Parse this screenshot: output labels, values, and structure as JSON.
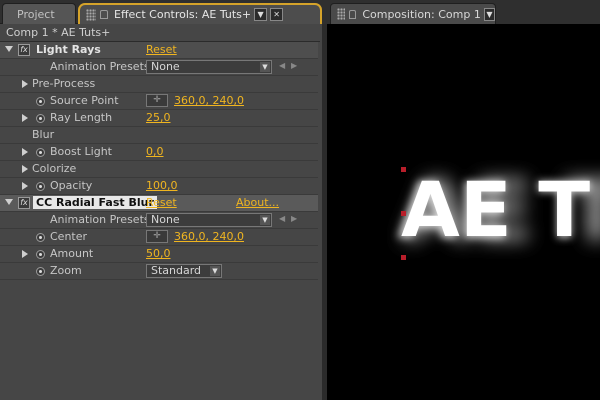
{
  "tabs": {
    "project": "Project",
    "effect_controls": "Effect Controls: AE Tuts+",
    "composition": "Composition: Comp 1"
  },
  "panel": {
    "comp_label": "Comp 1 * AE Tuts+"
  },
  "effects": [
    {
      "name": "Light Rays",
      "reset": "Reset",
      "presets_label": "Animation Presets:",
      "presets_value": "None",
      "params": {
        "pre_process": "Pre-Process",
        "source_point_label": "Source Point",
        "source_point_value": "360,0, 240,0",
        "ray_length_label": "Ray Length",
        "ray_length_value": "25,0",
        "blur": "Blur",
        "boost_light_label": "Boost Light",
        "boost_light_value": "0,0",
        "colorize": "Colorize",
        "opacity_label": "Opacity",
        "opacity_value": "100,0"
      }
    },
    {
      "name": "CC Radial Fast Blur",
      "reset": "Reset",
      "about": "About...",
      "presets_label": "Animation Presets:",
      "presets_value": "None",
      "params": {
        "center_label": "Center",
        "center_value": "360,0, 240,0",
        "amount_label": "Amount",
        "amount_value": "50,0",
        "zoom_label": "Zoom",
        "zoom_value": "Standard"
      }
    }
  ],
  "viewer": {
    "text": "AE T",
    "handle_color": "#b81e2a",
    "background": "#000000"
  },
  "colors": {
    "accent": "#f0b520",
    "panel_highlight": "#d5a32a"
  }
}
